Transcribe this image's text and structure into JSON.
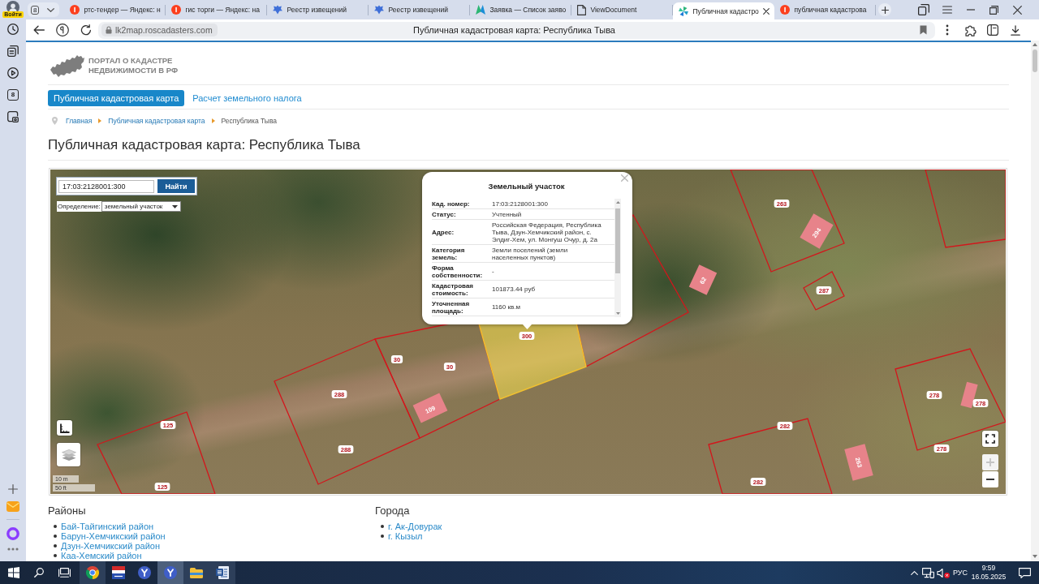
{
  "browser": {
    "profile": {
      "label": "Войти"
    },
    "sidebar": {
      "top": [
        {
          "kind": "history"
        },
        {
          "kind": "collections"
        },
        {
          "kind": "video"
        },
        {
          "kind": "counter",
          "label": "8"
        },
        {
          "kind": "screenshot"
        }
      ],
      "bottom": [
        {
          "kind": "add"
        },
        {
          "kind": "mail"
        },
        {
          "kind": "assistant"
        },
        {
          "kind": "more"
        }
      ]
    },
    "tab_counter": "8",
    "tabs": [
      {
        "title": "ртс-тендер — Яндекс: н",
        "kind": "yandex",
        "selected": false
      },
      {
        "title": "гис торги — Яндекс: на",
        "kind": "yandex",
        "selected": false
      },
      {
        "title": "Реестр извещений",
        "kind": "emblem",
        "selected": false
      },
      {
        "title": "Реестр извещений",
        "kind": "emblem",
        "selected": false
      },
      {
        "title": "Заявка — Список заяво",
        "kind": "peaks",
        "selected": false
      },
      {
        "title": "ViewDocument",
        "kind": "document",
        "selected": false
      },
      {
        "title": "Публичная кадастро",
        "kind": "pinwheel",
        "selected": true
      },
      {
        "title": "публичная кадастрова",
        "kind": "yandex",
        "selected": false
      }
    ],
    "address": {
      "domain": "lk2map.roscadasters.com",
      "title": "Публичная кадастровая карта: Республика Тыва"
    }
  },
  "site": {
    "logo_text": [
      "ПОРТАЛ О КАДАСТРЕ",
      "НЕДВИЖИМОСТИ В РФ"
    ],
    "nav": [
      {
        "label": "Публичная кадастровая карта",
        "selected": true
      },
      {
        "label": "Расчет земельного налога",
        "selected": false
      }
    ],
    "breadcrumbs": [
      {
        "label": "Главная",
        "link": true
      },
      {
        "label": "Публичная кадастровая карта",
        "link": true
      },
      {
        "label": "Республика Тыва",
        "link": false
      }
    ],
    "heading": "Публичная кадастровая карта: Республика Тыва"
  },
  "map": {
    "search": {
      "value": "17:03:2128001:300",
      "button": "Найти"
    },
    "identify": {
      "label": "Определение:",
      "value": "земельный участок"
    },
    "labels": [
      {
        "text": "263",
        "kind": "parcel"
      },
      {
        "text": "294",
        "kind": "building"
      },
      {
        "text": "62",
        "kind": "building"
      },
      {
        "text": "287",
        "kind": "parcel"
      },
      {
        "text": "300",
        "kind": "parcel"
      },
      {
        "text": "30",
        "kind": "parcel"
      },
      {
        "text": "30",
        "kind": "parcel"
      },
      {
        "text": "288",
        "kind": "parcel"
      },
      {
        "text": "278",
        "kind": "parcel"
      },
      {
        "text": "278",
        "kind": "parcel"
      },
      {
        "text": "109",
        "kind": "building"
      },
      {
        "text": "125",
        "kind": "parcel"
      },
      {
        "text": "282",
        "kind": "parcel"
      },
      {
        "text": "288",
        "kind": "parcel"
      },
      {
        "text": "278",
        "kind": "parcel"
      },
      {
        "text": "263",
        "kind": "building"
      },
      {
        "text": "282",
        "kind": "parcel"
      },
      {
        "text": "125",
        "kind": "parcel"
      }
    ],
    "popup": {
      "title": "Земельный участок",
      "rows": [
        {
          "label": "Кад. номер:",
          "value": "17:03:2128001:300"
        },
        {
          "label": "Статус:",
          "value": "Учтенный"
        },
        {
          "label": "Адрес:",
          "value": "Российская Федерация, Республика Тыва, Дзун-Хемчикский район, с. Элдиг-Хем, ул. Монгуш Очур, д. 2а"
        },
        {
          "label": "Категория земель:",
          "value": "Земли поселений (земли населенных пунктов)"
        },
        {
          "label": "Форма собственности:",
          "value": "-"
        },
        {
          "label": "Кадастровая стоимость:",
          "value": "101873.44 руб"
        },
        {
          "label": "Уточненная площадь:",
          "value": "1160 кв.м"
        }
      ]
    },
    "scale": [
      "10 m",
      "50 ft"
    ],
    "zoom": [
      {
        "kind": "in",
        "disabled": true
      },
      {
        "kind": "out",
        "disabled": false
      }
    ]
  },
  "directory": [
    {
      "heading": "Районы",
      "links": [
        "Бай-Тайгинский район",
        "Барун-Хемчикский район",
        "Дзун-Хемчикский район",
        "Каа-Хемский район"
      ]
    },
    {
      "heading": "Города",
      "links": [
        "г. Ак-Довурак",
        "г. Кызыл"
      ]
    }
  ],
  "taskbar": {
    "apps": [
      {
        "kind": "chrome",
        "running": true,
        "selected": false
      },
      {
        "kind": "tile",
        "running": false,
        "selected": false
      },
      {
        "kind": "yandex",
        "running": false,
        "selected": false
      },
      {
        "kind": "yandex",
        "running": true,
        "selected": true
      },
      {
        "kind": "folder",
        "running": true,
        "selected": false
      },
      {
        "kind": "word",
        "running": true,
        "selected": false
      }
    ],
    "language": "РУС",
    "time": "9:59",
    "date": "16.05.2025",
    "volume_muted": true
  }
}
